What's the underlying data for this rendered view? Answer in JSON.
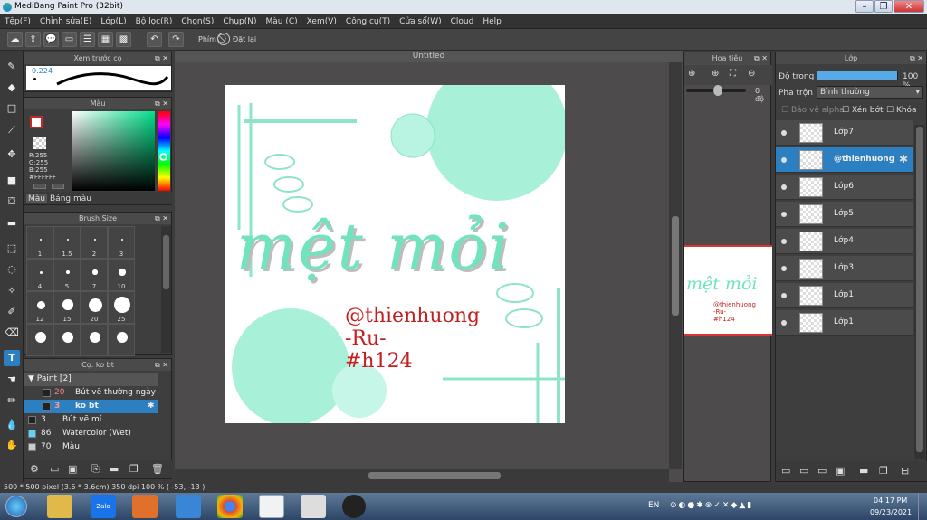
{
  "window": {
    "title": "MediBang Paint Pro (32bit)"
  },
  "menu": [
    "Tệp(F)",
    "Chỉnh sửa(E)",
    "Lớp(L)",
    "Bộ lọc(R)",
    "Chọn(S)",
    "Chụp(N)",
    "Màu (C)",
    "Xem(V)",
    "Công cụ(T)",
    "Cửa sổ(W)",
    "Cloud",
    "Help"
  ],
  "toolbar": {
    "shortcut_label": "Phím",
    "reset_label": "Đặt lại"
  },
  "preview_panel": {
    "title": "Xem trước cọ",
    "size_value": "0.224"
  },
  "color_panel": {
    "title": "Màu",
    "rgb": [
      "R:255",
      "G:255",
      "B:255"
    ],
    "hex": "#FFFFFF",
    "tabs": [
      "Màu",
      "Bảng màu"
    ],
    "main_color": "#c62828",
    "hue_indicator": "#6ef5c8"
  },
  "brush_size_panel": {
    "title": "Brush Size",
    "sizes": [
      "1",
      "1.5",
      "2",
      "3",
      "4",
      "5",
      "7",
      "10",
      "12",
      "15",
      "20",
      "25",
      "",
      "",
      "",
      ""
    ]
  },
  "brush_panel": {
    "title": "Cọ: ko bt",
    "group": "Paint [2]",
    "items": [
      {
        "size": "20",
        "name": "Bút vẽ thường ngày"
      },
      {
        "size": "3",
        "name": "ko bt"
      },
      {
        "size": "3",
        "name": "Bút vẽ mí"
      },
      {
        "size": "86",
        "name": "Watercolor (Wet)"
      },
      {
        "size": "70",
        "name": "Màu"
      }
    ]
  },
  "canvas": {
    "tab_title": "Untitled",
    "art_text_main": "mệt mỏi",
    "watermark_lines": [
      "@thienhuong",
      "-Ru-",
      "#h124"
    ],
    "accent": "#5fe3b8"
  },
  "navigator": {
    "title": "Hoa tiêu",
    "angle": "0 độ",
    "preview_text": "mệt mỏi"
  },
  "layer_panel": {
    "title": "Lớp",
    "opacity_label": "Độ trong",
    "opacity_value": "100 %",
    "blend_label": "Pha trộn",
    "blend_value": "Bình thường",
    "protect_alpha": "Bảo vệ alpha",
    "clipping": "Xén bớt",
    "lock": "Khóa",
    "layers": [
      "Lớp7",
      "@thienhuong",
      "Lớp6",
      "Lớp5",
      "Lớp4",
      "Lớp3",
      "Lớp1",
      "Lớp1"
    ],
    "selected_index": 1
  },
  "status": {
    "text": "500 * 500 pixel  (3.6 * 3.6cm)  350 dpi  100 %  ( -53, -13 )"
  },
  "taskbar": {
    "lang": "EN",
    "time": "04:17 PM",
    "date": "09/23/2021",
    "zalo": "Zalo"
  }
}
